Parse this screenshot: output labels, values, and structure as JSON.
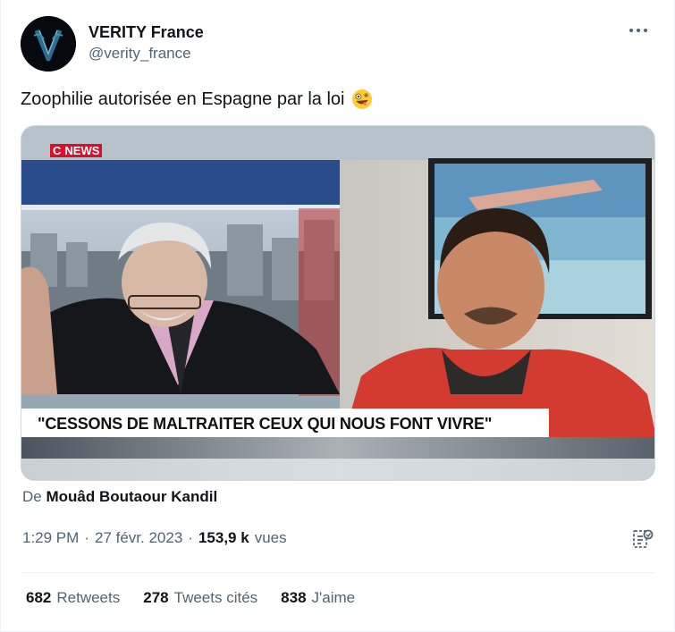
{
  "author": {
    "display_name": "VERITY France",
    "handle": "@verity_france"
  },
  "tweet": {
    "text": "Zoophilie autorisée en Espagne par la loi",
    "emoji": "zany-face-emoji"
  },
  "media": {
    "channel_logo": "NEWS",
    "channel_logo_prefix": "C",
    "caption": "\"CESSONS DE MALTRAITER CEUX QUI NOUS FONT VIVRE\""
  },
  "attribution": {
    "prefix": "De",
    "name": "Mouâd Boutaour Kandil"
  },
  "meta": {
    "time": "1:29 PM",
    "separator": "·",
    "date": "27 févr. 2023",
    "views_count": "153,9 k",
    "views_label": "vues"
  },
  "stats": {
    "retweets_count": "682",
    "retweets_label": "Retweets",
    "quotes_count": "278",
    "quotes_label": "Tweets cités",
    "likes_count": "838",
    "likes_label": "J'aime"
  },
  "colors": {
    "text_primary": "#0f1419",
    "text_secondary": "#536471",
    "border": "#eff3f4",
    "news_red": "#d8102b"
  }
}
